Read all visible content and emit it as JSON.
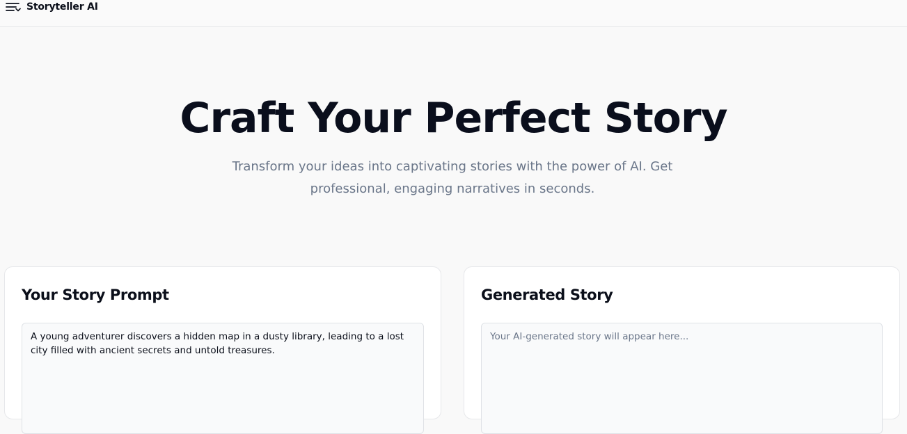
{
  "app": {
    "brand": "Storyteller AI",
    "menu_icon": "menu-icon"
  },
  "hero": {
    "title": "Craft Your Perfect Story",
    "subtitle": "Transform your ideas into captivating stories with the power of AI. Get professional, engaging narratives in seconds."
  },
  "prompt_card": {
    "title": "Your Story Prompt",
    "value": "A young adventurer discovers a hidden map in a dusty library, leading to a lost city filled with ancient secrets and untold treasures."
  },
  "output_card": {
    "title": "Generated Story",
    "placeholder": "Your AI-generated story will appear here..."
  },
  "colors": {
    "background": "#f9f9f9",
    "text_primary": "#0b0f1a",
    "text_muted": "#6a7689",
    "border": "#e6e7ea"
  }
}
